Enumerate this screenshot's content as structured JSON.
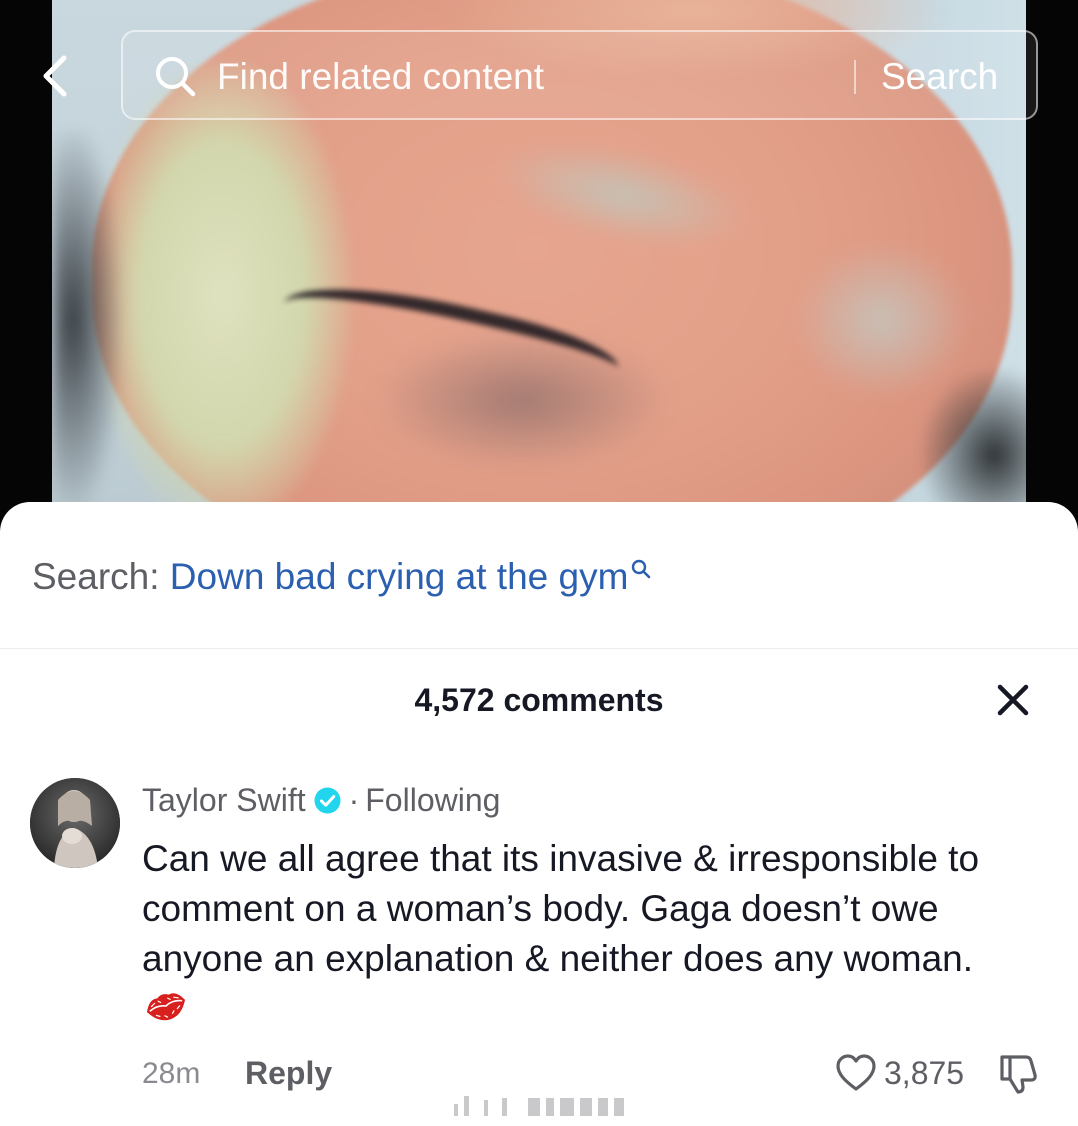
{
  "video": {
    "back_icon": "chevron-left-icon",
    "search": {
      "placeholder": "Find related content",
      "button_label": "Search",
      "icon": "search-icon"
    }
  },
  "related_search": {
    "prefix": "Search:",
    "query": "Down bad crying at the gym",
    "icon": "search-icon",
    "query_color": "#2b5fb0"
  },
  "comments_header": {
    "count_label": "4,572 comments",
    "close_icon": "close-icon"
  },
  "comment": {
    "author": "Taylor Swift",
    "verified": true,
    "verified_color": "#20d5ec",
    "separator": "·",
    "relation": "Following",
    "text": "Can we all agree that its invasive & irresponsible to comment on a woman’s body. Gaga doesn’t owe anyone an explanation & neither does any woman.",
    "emoji": "lips-icon",
    "time": "28m",
    "reply_label": "Reply",
    "likes": "3,875",
    "like_icon": "heart-outline-icon",
    "dislike_icon": "thumbs-down-icon"
  }
}
